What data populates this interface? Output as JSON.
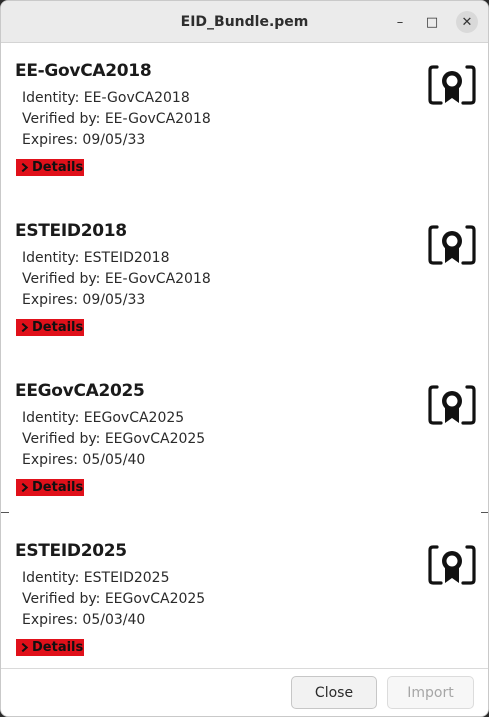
{
  "window": {
    "title": "EID_Bundle.pem",
    "minimize_glyph": "–",
    "maximize_glyph": "□",
    "close_glyph": "✕"
  },
  "labels": {
    "identity_prefix": "Identity: ",
    "verified_prefix": "Verified by: ",
    "expires_prefix": "Expires: ",
    "details": "Details"
  },
  "certificates": [
    {
      "name": "EE-GovCA2018",
      "identity": "Identity: EE-GovCA2018",
      "verified_by": "Verified by: EE-GovCA2018",
      "expires": "Expires: 09/05/33",
      "details_label": "Details",
      "icon": "certificate-icon"
    },
    {
      "name": "ESTEID2018",
      "identity": "Identity: ESTEID2018",
      "verified_by": "Verified by: EE-GovCA2018",
      "expires": "Expires: 09/05/33",
      "details_label": "Details",
      "icon": "certificate-icon"
    },
    {
      "name": "EEGovCA2025",
      "identity": "Identity: EEGovCA2025",
      "verified_by": "Verified by: EEGovCA2025",
      "expires": "Expires: 05/05/40",
      "details_label": "Details",
      "icon": "certificate-icon"
    },
    {
      "name": "ESTEID2025",
      "identity": "Identity: ESTEID2025",
      "verified_by": "Verified by: EEGovCA2025",
      "expires": "Expires: 05/03/40",
      "details_label": "Details",
      "icon": "certificate-icon"
    }
  ],
  "footer": {
    "close_label": "Close",
    "import_label": "Import",
    "import_enabled": false
  },
  "colors": {
    "details_bg": "#e0101a",
    "titlebar_bg": "#ebebeb",
    "window_bg": "#ffffff",
    "disabled_text": "#a6a6a6"
  }
}
